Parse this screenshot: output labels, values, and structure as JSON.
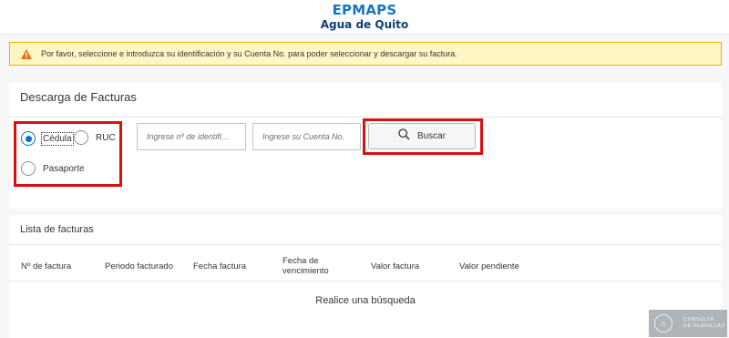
{
  "header": {
    "brand_title": "EPMAPS",
    "brand_subtitle": "Agua de Quito"
  },
  "warning": {
    "icon": "warning-triangle-icon",
    "text": "Por favor, seleccione e introduzca su identificación y su Cuenta No. para poder seleccionar y descargar su factura."
  },
  "download_panel": {
    "title": "Descarga de Facturas",
    "id_types": [
      {
        "label": "Cédula",
        "selected": true
      },
      {
        "label": "RUC",
        "selected": false
      },
      {
        "label": "Pasaporte",
        "selected": false
      }
    ],
    "id_input": {
      "placeholder": "Ingrese nº de identifi…",
      "value": ""
    },
    "account_input": {
      "placeholder": "Ingrese su Cuenta No.",
      "value": ""
    },
    "search_button": {
      "label": "Buscar",
      "icon": "search-icon"
    }
  },
  "invoice_list": {
    "title": "Lista de facturas",
    "columns": [
      "Nº de factura",
      "Periodo facturado",
      "Fecha factura",
      "Fecha de vencimiento",
      "Valor factura",
      "Valor pendiente"
    ],
    "empty_message": "Realice una búsqueda"
  },
  "watermark": {
    "line1": "CONSULTA",
    "line2": "DE PLANILLAS"
  },
  "colors": {
    "accent": "#0a6ed1",
    "brand": "#1b75bb",
    "highlight": "#d9100f",
    "warning_bg": "#fef7c5",
    "warning_icon": "#e9730c"
  }
}
